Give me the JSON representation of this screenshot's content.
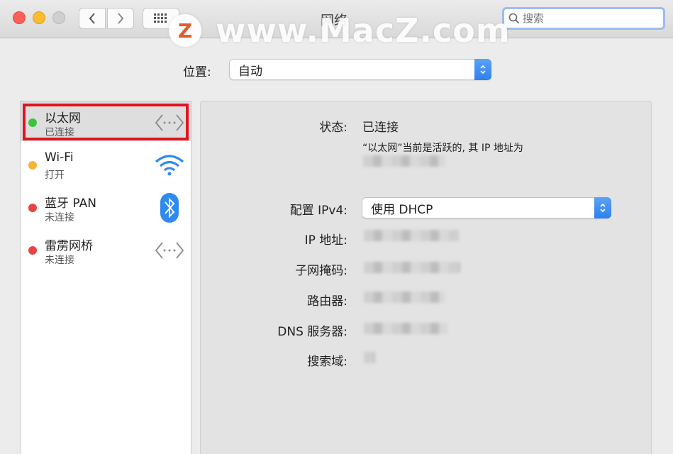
{
  "window": {
    "title": "网络"
  },
  "toolbar": {
    "search_placeholder": "搜索",
    "back_icon": "chevron-left-icon",
    "forward_icon": "chevron-right-icon",
    "grid_icon": "grid-icon"
  },
  "watermark": {
    "logo_letter": "Z",
    "text": "www.MacZ.com"
  },
  "location": {
    "label": "位置:",
    "value": "自动"
  },
  "services": [
    {
      "name": "以太网",
      "status": "已连接",
      "dot_color": "#3cc33d",
      "icon": "ethernet-arrows-icon",
      "selected": true
    },
    {
      "name": "Wi-Fi",
      "status": "打开",
      "dot_color": "#f6b33a",
      "icon": "wifi-icon",
      "selected": false
    },
    {
      "name": "蓝牙 PAN",
      "status": "未连接",
      "dot_color": "#e84343",
      "icon": "bluetooth-icon",
      "selected": false
    },
    {
      "name": "雷雳网桥",
      "status": "未连接",
      "dot_color": "#e84343",
      "icon": "thunderbolt-bridge-arrows-icon",
      "selected": false
    }
  ],
  "detail": {
    "status_label": "状态:",
    "status_value": "已连接",
    "status_desc": "“以太网”当前是活跃的, 其 IP 地址为",
    "ipv4_label": "配置 IPv4:",
    "ipv4_value": "使用 DHCP",
    "ip_label": "IP 地址:",
    "subnet_label": "子网掩码:",
    "router_label": "路由器:",
    "dns_label": "DNS 服务器:",
    "search_domain_label": "搜索域:"
  },
  "colors": {
    "accent": "#2f7fef",
    "highlight_border": "#e0141f"
  }
}
